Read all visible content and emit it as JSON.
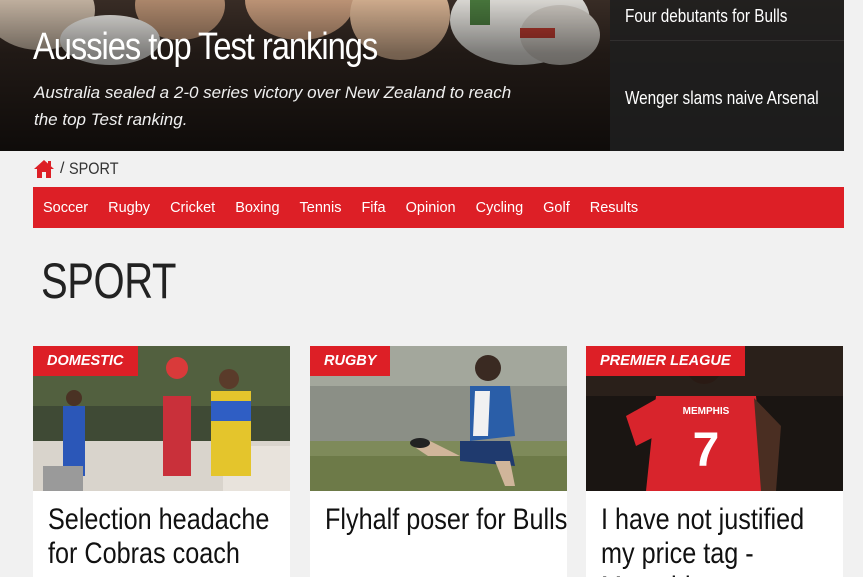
{
  "hero": {
    "title": "Aussies top Test rankings",
    "summary": "Australia sealed a 2-0 series victory over New Zealand to reach the top Test ranking.",
    "side_items": [
      "Four debutants for Bulls",
      "Wenger slams naive Arsenal"
    ]
  },
  "breadcrumb": {
    "separator": "/",
    "current": "SPORT"
  },
  "nav": {
    "items": [
      "Soccer",
      "Rugby",
      "Cricket",
      "Boxing",
      "Tennis",
      "Fifa",
      "Opinion",
      "Cycling",
      "Golf",
      "Results"
    ]
  },
  "page": {
    "title": "SPORT"
  },
  "cards": [
    {
      "tag": "DOMESTIC",
      "headline": "Selection headache for Cobras coach"
    },
    {
      "tag": "RUGBY",
      "headline": "Flyhalf poser for Bulls"
    },
    {
      "tag": "PREMIER LEAGUE",
      "headline": "I have not justified my price tag - Memphis",
      "shirt_name": "MEMPHIS",
      "shirt_number": "7"
    }
  ],
  "colors": {
    "accent": "#dd1f26",
    "page_bg": "#f1f1f1"
  }
}
